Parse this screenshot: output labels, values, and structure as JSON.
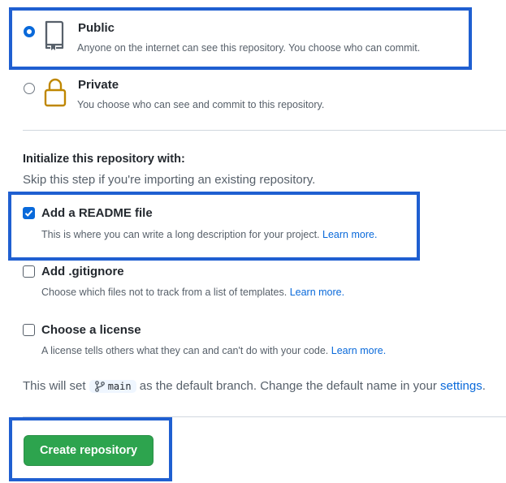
{
  "visibility": {
    "public": {
      "title": "Public",
      "description": "Anyone on the internet can see this repository. You choose who can commit.",
      "checked": true
    },
    "private": {
      "title": "Private",
      "description": "You choose who can see and commit to this repository.",
      "checked": false
    }
  },
  "initialize": {
    "title": "Initialize this repository with:",
    "subtitle": "Skip this step if you're importing an existing repository.",
    "readme": {
      "label": "Add a README file",
      "description": "This is where you can write a long description for your project.",
      "link": "Learn more.",
      "checked": true
    },
    "gitignore": {
      "label": "Add .gitignore",
      "description": "Choose which files not to track from a list of templates.",
      "link": "Learn more.",
      "checked": false
    },
    "license": {
      "label": "Choose a license",
      "description": "A license tells others what they can and can't do with your code.",
      "link": "Learn more.",
      "checked": false
    }
  },
  "branch_note": {
    "prefix": "This will set",
    "branch": "main",
    "suffix": "as the default branch. Change the default name in your",
    "link": "settings",
    "end": "."
  },
  "create_button": "Create repository",
  "colors": {
    "accent": "#0969da",
    "primary_button": "#2da44e",
    "highlight_border": "#1f5fd1"
  },
  "icons": [
    "repo-public-icon",
    "lock-icon",
    "git-branch-icon",
    "check-icon"
  ]
}
